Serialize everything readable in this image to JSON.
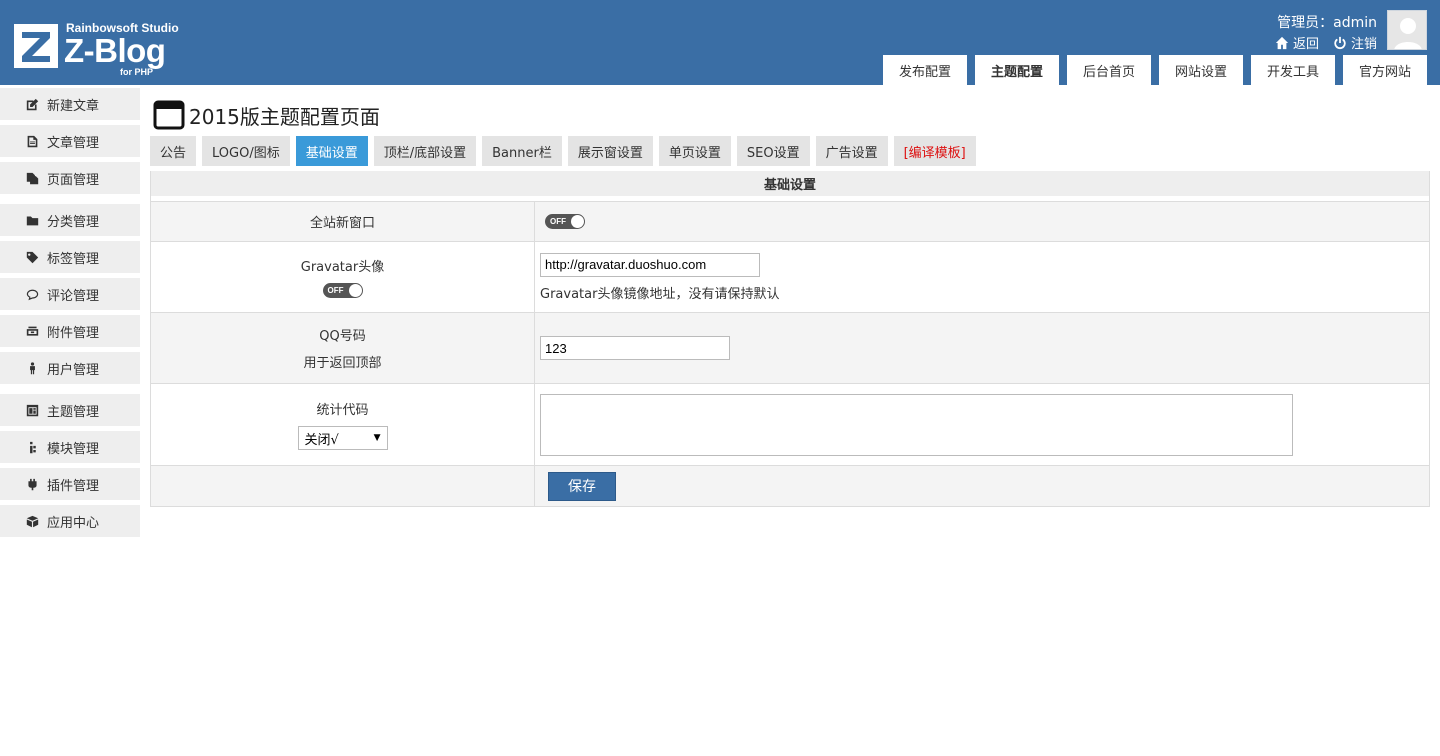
{
  "brand": {
    "studio": "Rainbowsoft Studio",
    "name": "Z-Blog",
    "sub": "for PHP"
  },
  "user": {
    "label": "管理员：admin",
    "back": "返回",
    "logout": "注销"
  },
  "top_nav": [
    {
      "label": "发布配置",
      "active": false
    },
    {
      "label": "主题配置",
      "active": true
    },
    {
      "label": "后台首页",
      "active": false
    },
    {
      "label": "网站设置",
      "active": false
    },
    {
      "label": "开发工具",
      "active": false
    },
    {
      "label": "官方网站",
      "active": false
    }
  ],
  "sidebar": {
    "items": [
      {
        "label": "新建文章",
        "icon": "edit-icon"
      },
      {
        "label": "文章管理",
        "icon": "document-icon"
      },
      {
        "label": "页面管理",
        "icon": "pages-icon"
      },
      {
        "label": "分类管理",
        "icon": "folder-icon"
      },
      {
        "label": "标签管理",
        "icon": "tag-icon"
      },
      {
        "label": "评论管理",
        "icon": "comment-icon"
      },
      {
        "label": "附件管理",
        "icon": "attachment-icon"
      },
      {
        "label": "用户管理",
        "icon": "user-icon"
      },
      {
        "label": "主题管理",
        "icon": "theme-icon"
      },
      {
        "label": "模块管理",
        "icon": "module-icon"
      },
      {
        "label": "插件管理",
        "icon": "plugin-icon"
      },
      {
        "label": "应用中心",
        "icon": "box-icon"
      }
    ]
  },
  "page": {
    "title": "2015版主题配置页面"
  },
  "sub_tabs": [
    {
      "label": "公告"
    },
    {
      "label": "LOGO/图标"
    },
    {
      "label": "基础设置"
    },
    {
      "label": "顶栏/底部设置"
    },
    {
      "label": "Banner栏"
    },
    {
      "label": "展示窗设置"
    },
    {
      "label": "单页设置"
    },
    {
      "label": "SEO设置"
    },
    {
      "label": "广告设置"
    },
    {
      "label": "[编译模板]"
    }
  ],
  "panel": {
    "heading": "基础设置",
    "rows": {
      "new_window": {
        "label": "全站新窗口",
        "toggle": "OFF"
      },
      "gravatar": {
        "label": "Gravatar头像",
        "toggle": "OFF",
        "value": "http://gravatar.duoshuo.com",
        "hint": "Gravatar头像镜像地址，没有请保持默认"
      },
      "qq": {
        "label": "QQ号码",
        "sublabel": "用于返回顶部",
        "value": "123"
      },
      "stats": {
        "label": "统计代码",
        "select_value": "关闭√",
        "code": ""
      },
      "save": {
        "label": "保存"
      }
    }
  },
  "colors": {
    "header_bg": "#3a6ea5",
    "active_tab": "#3a9ad9",
    "compile_red": "#d11111"
  }
}
